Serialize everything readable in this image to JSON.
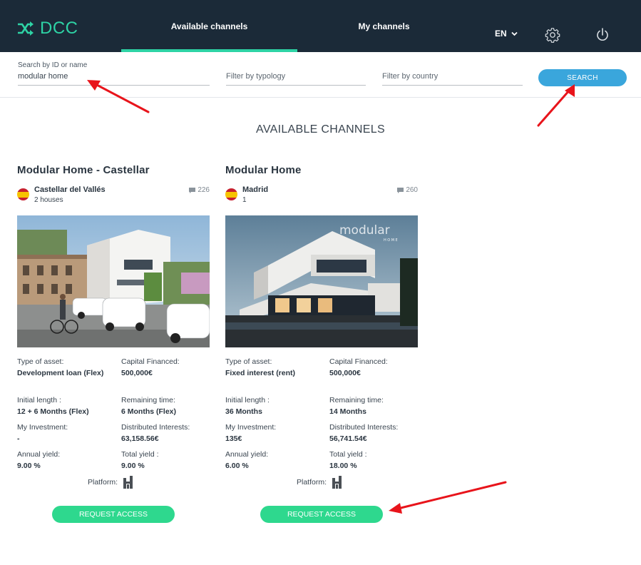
{
  "app": {
    "name": "DCC"
  },
  "nav": {
    "tabs": [
      {
        "label": "Available channels",
        "active": true
      },
      {
        "label": "My channels",
        "active": false
      }
    ],
    "language": "EN"
  },
  "search": {
    "name_label": "Search by ID or name",
    "name_value": "modular home",
    "typology_placeholder": "Filter by typology",
    "country_placeholder": "Filter by country",
    "button_label": "SEARCH"
  },
  "section_title": "AVAILABLE CHANNELS",
  "cards": [
    {
      "title": "Modular Home - Castellar",
      "city": "Castellar del Vallés",
      "units": "2 houses",
      "comments": "226",
      "image_icon": "construction-photo",
      "stats": {
        "type_label": "Type of asset:",
        "type_value": "Development loan (Flex)",
        "capital_label": "Capital Financed:",
        "capital_value": "500,000€",
        "initial_label": "Initial length :",
        "initial_value": "12 + 6 Months (Flex)",
        "remaining_label": "Remaining time:",
        "remaining_value": "6 Months (Flex)",
        "investment_label": "My Investment:",
        "investment_value": "-",
        "interests_label": "Distributed Interests:",
        "interests_value": "63,158.56€",
        "annual_label": "Annual yield:",
        "annual_value": "9.00 %",
        "total_label": "Total yield :",
        "total_value": "9.00 %"
      },
      "platform_label": "Platform:",
      "button_label": "REQUEST ACCESS"
    },
    {
      "title": "Modular Home",
      "city": "Madrid",
      "units": "1",
      "comments": "260",
      "image_icon": "modular-house-render",
      "image_watermark": "modular",
      "image_watermark_sub": "HOME",
      "stats": {
        "type_label": "Type of asset:",
        "type_value": "Fixed interest (rent)",
        "capital_label": "Capital Financed:",
        "capital_value": "500,000€",
        "initial_label": "Initial length :",
        "initial_value": "36 Months",
        "remaining_label": "Remaining time:",
        "remaining_value": "14 Months",
        "investment_label": "My Investment:",
        "investment_value": "135€",
        "interests_label": "Distributed Interests:",
        "interests_value": "56,741.54€",
        "annual_label": "Annual yield:",
        "annual_value": "6.00 %",
        "total_label": "Total yield :",
        "total_value": "18.00 %"
      },
      "platform_label": "Platform:",
      "button_label": "REQUEST ACCESS"
    }
  ],
  "colors": {
    "topbar": "#1b2a38",
    "accent_green": "#2ed3a5",
    "request_button": "#2ed88e",
    "search_button": "#3aa6dc",
    "annotation_arrow": "#e8141b"
  }
}
